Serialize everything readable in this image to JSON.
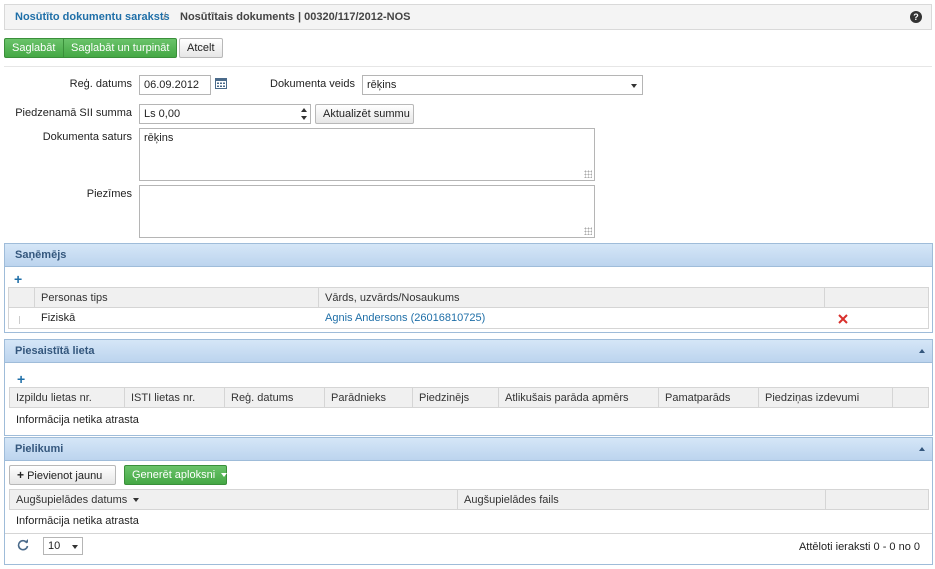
{
  "breadcrumb": {
    "link": "Nosūtīto dokumentu saraksts",
    "separator": "/",
    "current": "Nosūtītais dokuments | 00320/117/2012-NOS",
    "help": "?"
  },
  "toolbar": {
    "save": "Saglabāt",
    "save_continue": "Saglabāt un turpināt",
    "cancel": "Atcelt"
  },
  "form": {
    "reg_date_label": "Reģ. datums",
    "reg_date_value": "06.09.2012",
    "doc_type_label": "Dokumenta veids",
    "doc_type_value": "rēķins",
    "amount_label": "Piedzenamā SII summa",
    "amount_value": "Ls 0,00",
    "update_amount": "Aktualizēt summu",
    "content_label": "Dokumenta saturs",
    "content_value": "rēķins",
    "notes_label": "Piezīmes",
    "notes_value": ""
  },
  "recipient": {
    "title": "Saņēmējs",
    "columns": [
      "Personas tips",
      "Vārds, uzvārds/Nosaukums"
    ],
    "rows": [
      {
        "type": "Fiziskā",
        "name": "Agnis Andersons (26016810725)"
      }
    ]
  },
  "linked_case": {
    "title": "Piesaistītā lieta",
    "columns": [
      "Izpildu lietas nr.",
      "ISTI lietas nr.",
      "Reģ. datums",
      "Parādnieks",
      "Piedzinējs",
      "Atlikušais parāda apmērs",
      "Pamatparāds",
      "Piedziņas izdevumi"
    ],
    "empty": "Informācija netika atrasta"
  },
  "attachments": {
    "title": "Pielikumi",
    "add_new": "Pievienot jaunu",
    "generate_envelope": "Ģenerēt aploksni",
    "columns": [
      "Augšupielādes datums",
      "Augšupielādes fails"
    ],
    "empty": "Informācija netika atrasta",
    "page_size": "10",
    "records_info": "Attēloti ieraksti 0 - 0 no 0"
  },
  "colors": {
    "accent": "#1f6fa8",
    "success": "#45a845",
    "panel_header": "#bcd4ee",
    "delete": "#d9302c"
  }
}
